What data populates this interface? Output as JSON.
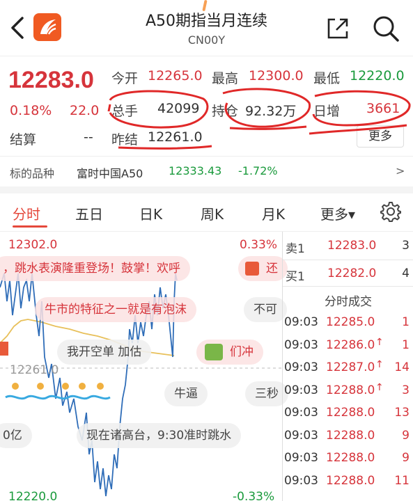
{
  "header": {
    "title": "A50期指当月连续",
    "subtitle": "CN00Y"
  },
  "quote": {
    "price": "12283.0",
    "change_pct": "0.18%",
    "change_val": "22.0",
    "open_label": "今开",
    "open_value": "12265.0",
    "high_label": "最高",
    "high_value": "12300.0",
    "low_label": "最低",
    "low_value": "12220.0",
    "volume_label": "总手",
    "volume_value": "42099",
    "oi_label": "持仓",
    "oi_value": "92.32万",
    "daily_inc_label": "日增",
    "daily_inc_value": "3661",
    "settle_label": "结算",
    "settle_value": "--",
    "prev_settle_label": "昨结",
    "prev_settle_value": "12261.0",
    "more_label": "更多"
  },
  "underlying": {
    "label": "标的品种",
    "name": "富时中国A50",
    "price": "12333.43",
    "change": "-1.72%",
    "arrow": ">"
  },
  "tabs": [
    {
      "label": "分时"
    },
    {
      "label": "五日"
    },
    {
      "label": "日K"
    },
    {
      "label": "周K"
    },
    {
      "label": "月K"
    },
    {
      "label": "更多▾"
    }
  ],
  "chart": {
    "top_price": "12302.0",
    "top_pct": "0.33%",
    "mid_price": "12261.0",
    "bottom_price": "12220.0",
    "bottom_pct": "-0.33%",
    "left_clip_text": "0亿",
    "colors": {
      "price_line": "#2f6db8",
      "avg_line": "#e8c05a",
      "annotation": "#e03030"
    }
  },
  "bubbles": {
    "b1": "，跳水表演隆重登场！鼓掌！欢呼",
    "b1_right": "还",
    "b2": "牛市的特征之一就是有泡沫",
    "b2_right": "不可",
    "b3": "我开空单 加估",
    "b3_right": "们冲",
    "b4": "牛逼",
    "b4_right": "三秒",
    "b5": "现在诸高台，9:30准时跳水"
  },
  "orderbook": {
    "ask_label": "卖1",
    "ask_price": "12283.0",
    "ask_qty": "3",
    "bid_label": "买1",
    "bid_price": "12282.0",
    "bid_qty": "4",
    "trades_title": "分时成交",
    "trades": [
      {
        "time": "09:03",
        "price": "12285.0",
        "arrow": "",
        "qty": "1"
      },
      {
        "time": "09:03",
        "price": "12286.0",
        "arrow": "↑",
        "qty": "1"
      },
      {
        "time": "09:03",
        "price": "12287.0",
        "arrow": "↑",
        "qty": "14"
      },
      {
        "time": "09:03",
        "price": "12288.0",
        "arrow": "↑",
        "qty": "3"
      },
      {
        "time": "09:03",
        "price": "12288.0",
        "arrow": "",
        "qty": "13"
      },
      {
        "time": "09:03",
        "price": "12288.0",
        "arrow": "",
        "qty": "9"
      },
      {
        "time": "09:03",
        "price": "12288.0",
        "arrow": "",
        "qty": "9"
      },
      {
        "time": "09:03",
        "price": "12288.0",
        "arrow": "",
        "qty": "11"
      }
    ]
  }
}
